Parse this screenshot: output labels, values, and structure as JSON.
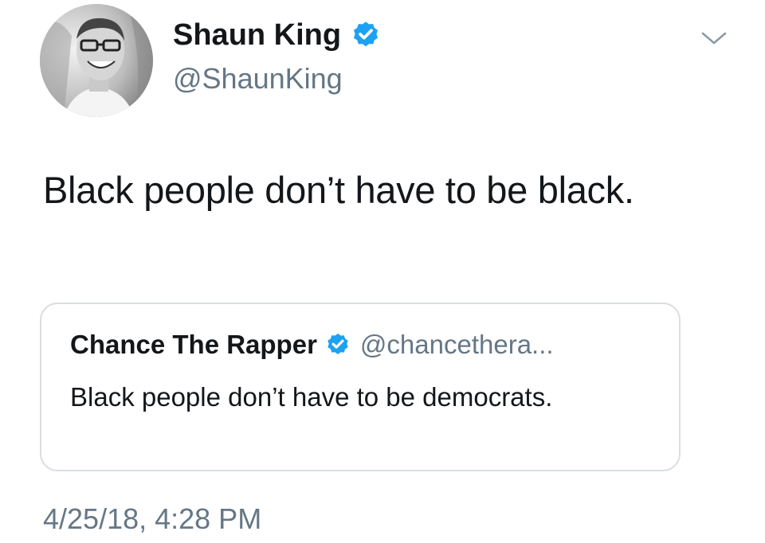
{
  "author": {
    "display_name": "Shaun King",
    "handle": "@ShaunKing",
    "verified_icon": "verified-badge-icon",
    "avatar": "profile-photo"
  },
  "menu_icon": "chevron-down-icon",
  "tweet": {
    "text": "Black people don’t have to be black.",
    "timestamp": "4/25/18, 4:28 PM"
  },
  "quoted_tweet": {
    "display_name": "Chance The Rapper",
    "handle": "@chancethera...",
    "verified_icon": "verified-badge-icon",
    "text": "Black people don’t have to be democrats."
  },
  "colors": {
    "verified_blue": "#1da1f2",
    "secondary_text": "#657786",
    "primary_text": "#14171a",
    "card_border": "#d9dee2"
  }
}
